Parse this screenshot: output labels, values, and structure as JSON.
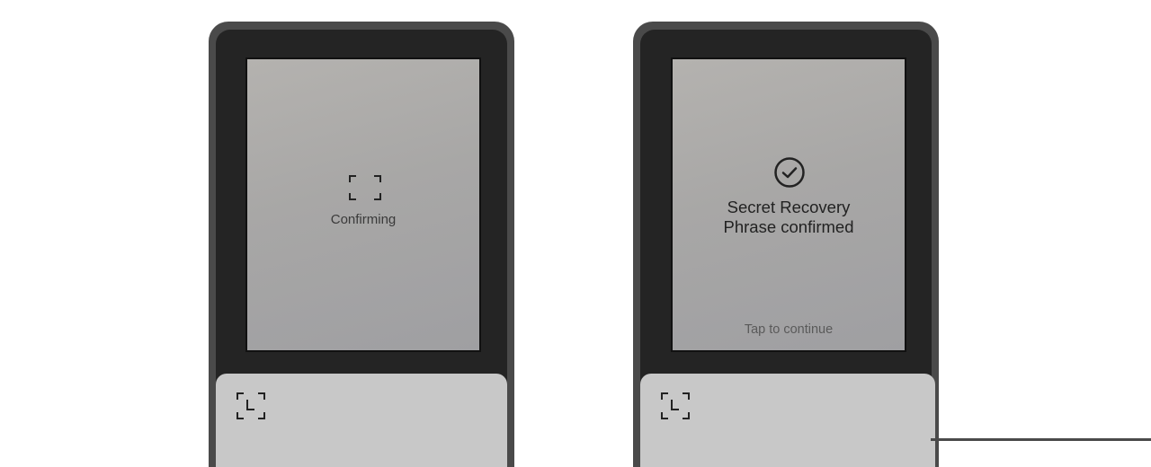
{
  "devices": [
    {
      "state": "confirming",
      "status_text": "Confirming",
      "scan_icon": "scan-frame-icon",
      "footer_icon": "scan-frame-l-icon"
    },
    {
      "state": "confirmed",
      "check_icon": "check-circle-icon",
      "title_line1": "Secret Recovery",
      "title_line2": "Phrase confirmed",
      "tap_text": "Tap to continue",
      "footer_icon": "scan-frame-l-icon"
    }
  ]
}
